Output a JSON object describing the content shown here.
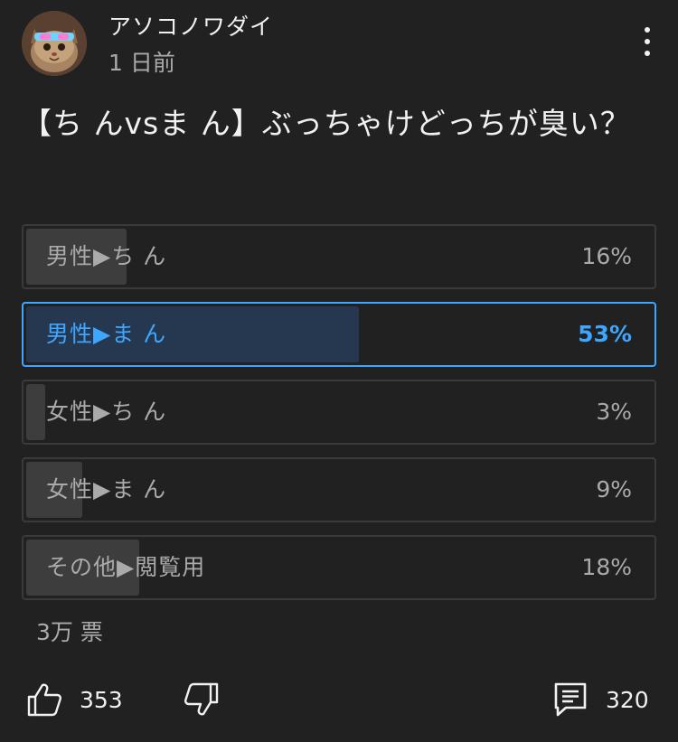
{
  "header": {
    "channel_name": "アソコノワダイ",
    "post_time": "1 日前"
  },
  "post": {
    "question": "【ち んvsま ん】ぶっちゃけどっちが臭い？"
  },
  "poll": {
    "options": [
      {
        "label": "男性▶ち ん",
        "percent": "16%",
        "fraction": 0.16,
        "selected": false
      },
      {
        "label": "男性▶ま ん",
        "percent": "53%",
        "fraction": 0.53,
        "selected": true
      },
      {
        "label": "女性▶ち ん",
        "percent": "3%",
        "fraction": 0.03,
        "selected": false
      },
      {
        "label": "女性▶ま ん",
        "percent": "9%",
        "fraction": 0.09,
        "selected": false
      },
      {
        "label": "その他▶閲覧用",
        "percent": "18%",
        "fraction": 0.18,
        "selected": false
      }
    ],
    "vote_count": "3万 票"
  },
  "actions": {
    "like_count": "353",
    "comment_count": "320",
    "like_icon": "thumbs-up-icon",
    "dislike_icon": "thumbs-down-icon",
    "comment_icon": "comment-icon"
  },
  "colors": {
    "background": "#212121",
    "accent": "#3ea6ff",
    "selected_fill": "#263850",
    "bar_fill": "#3d3d3d"
  }
}
